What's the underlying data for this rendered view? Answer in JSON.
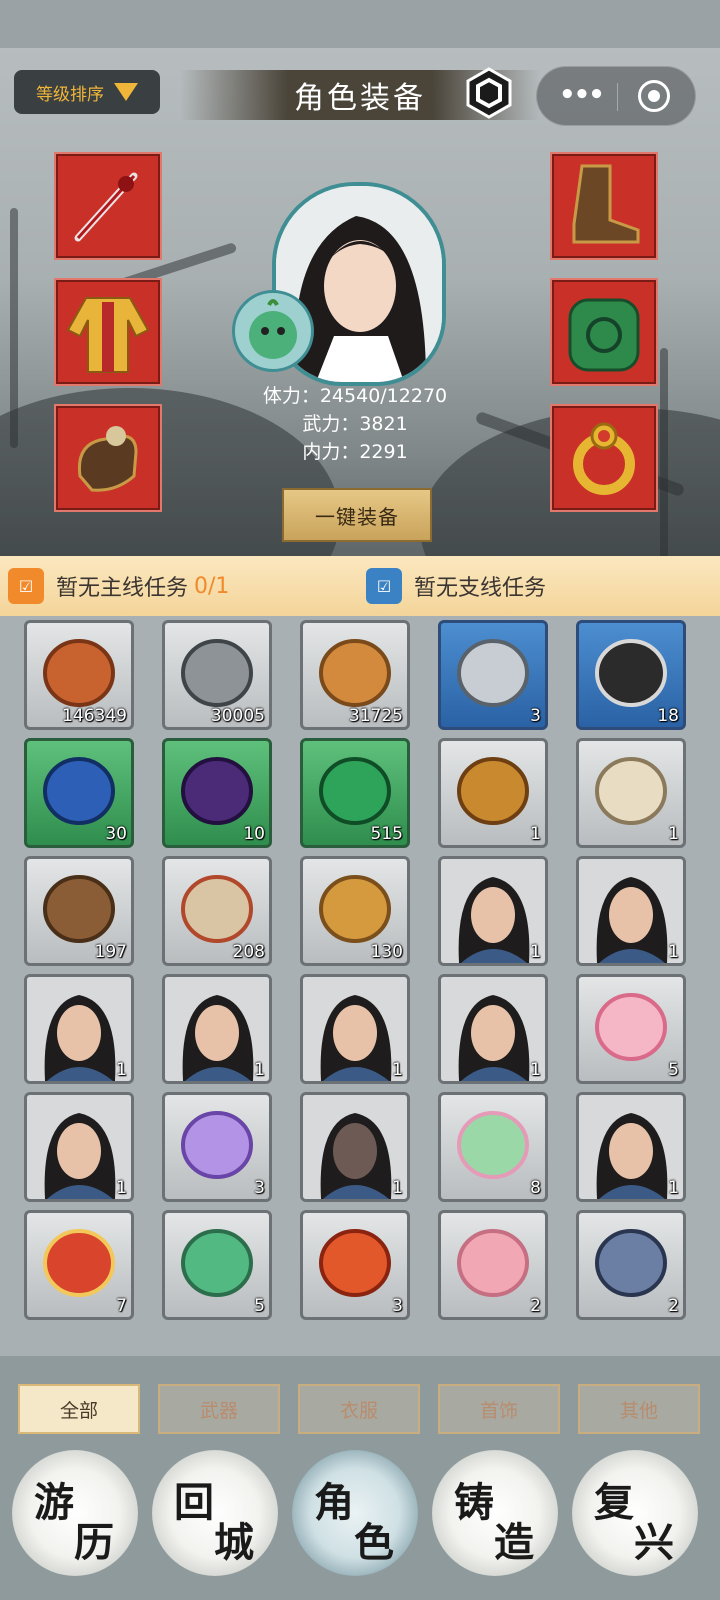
{
  "header": {
    "sort_label": "等级排序",
    "title": "角色装备",
    "icons": [
      "hex-settings-icon",
      "more-dots-icon",
      "capsule-close-icon"
    ]
  },
  "equipment": {
    "left": [
      "sword-icon",
      "golden-robe-icon",
      "gauntlet-icon"
    ],
    "right": [
      "boots-icon",
      "jade-amulet-icon",
      "gold-ring-icon"
    ]
  },
  "character": {
    "stats": {
      "hp": "体力：24540/12270",
      "atk": "武力：3821",
      "inner": "内力：2291"
    },
    "equip_all": "一键装备"
  },
  "quests": {
    "main_label": "暂无主线任务",
    "main_progress": "0/1",
    "side_label": "暂无支线任务",
    "main_color": "#f08a2a",
    "side_color": "#3a82c4"
  },
  "inventory": [
    {
      "name": "coin",
      "count": "146349",
      "rarity": "common"
    },
    {
      "name": "stone",
      "count": "30005",
      "rarity": "common"
    },
    {
      "name": "wood-log",
      "count": "31725",
      "rarity": "common"
    },
    {
      "name": "armor-pauldron",
      "count": "3",
      "rarity": "blue"
    },
    {
      "name": "ink-brush",
      "count": "18",
      "rarity": "blue"
    },
    {
      "name": "blue-vine",
      "count": "30",
      "rarity": "green"
    },
    {
      "name": "purple-vine",
      "count": "10",
      "rarity": "green"
    },
    {
      "name": "green-gem",
      "count": "515",
      "rarity": "green"
    },
    {
      "name": "chest",
      "count": "1",
      "rarity": "common"
    },
    {
      "name": "tent",
      "count": "1",
      "rarity": "common"
    },
    {
      "name": "net",
      "count": "197",
      "rarity": "common"
    },
    {
      "name": "whip",
      "count": "208",
      "rarity": "common"
    },
    {
      "name": "horse",
      "count": "130",
      "rarity": "common"
    },
    {
      "name": "bearded-warrior",
      "count": "1",
      "rarity": "common"
    },
    {
      "name": "masked-ninja",
      "count": "1",
      "rarity": "common"
    },
    {
      "name": "blue-robed-hero",
      "count": "1",
      "rarity": "common"
    },
    {
      "name": "long-haired-lady",
      "count": "1",
      "rarity": "common"
    },
    {
      "name": "braided-assassin",
      "count": "1",
      "rarity": "common"
    },
    {
      "name": "dark-swordsman",
      "count": "1",
      "rarity": "common"
    },
    {
      "name": "pink-fox",
      "count": "5",
      "rarity": "common"
    },
    {
      "name": "straw-hat-youth",
      "count": "1",
      "rarity": "common"
    },
    {
      "name": "purple-bat",
      "count": "3",
      "rarity": "common"
    },
    {
      "name": "red-eyed-demon",
      "count": "1",
      "rarity": "common"
    },
    {
      "name": "flower-sprite",
      "count": "8",
      "rarity": "common"
    },
    {
      "name": "masked-warrior",
      "count": "1",
      "rarity": "common"
    },
    {
      "name": "red-bird",
      "count": "7",
      "rarity": "common"
    },
    {
      "name": "green-snake",
      "count": "5",
      "rarity": "common"
    },
    {
      "name": "fire-dragon",
      "count": "3",
      "rarity": "common"
    },
    {
      "name": "pink-pig",
      "count": "2",
      "rarity": "common"
    },
    {
      "name": "horned-imp",
      "count": "2",
      "rarity": "common"
    }
  ],
  "filters": [
    "全部",
    "武器",
    "衣服",
    "首饰",
    "其他"
  ],
  "nav": [
    {
      "chars": [
        "游",
        "历"
      ]
    },
    {
      "chars": [
        "回",
        "城"
      ]
    },
    {
      "chars": [
        "角",
        "色"
      ]
    },
    {
      "chars": [
        "铸",
        "造"
      ]
    },
    {
      "chars": [
        "复",
        "兴"
      ]
    }
  ]
}
